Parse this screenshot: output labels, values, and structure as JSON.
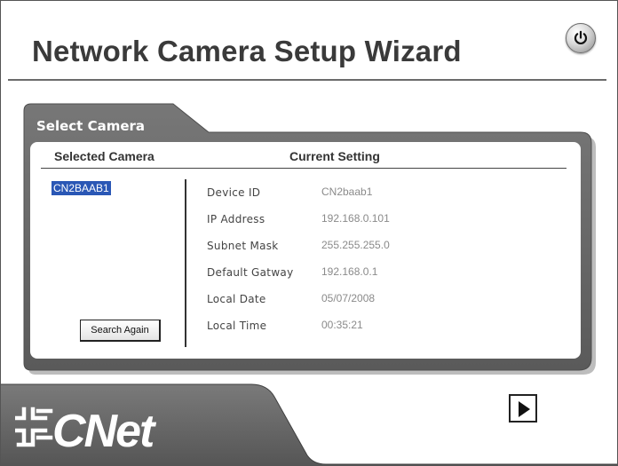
{
  "window": {
    "title": "Network Camera Setup Wizard"
  },
  "panel": {
    "title": "Select Camera",
    "left_header": "Selected Camera",
    "right_header": "Current Setting"
  },
  "camera_list": {
    "items": [
      "CN2BAAB1"
    ],
    "selected": "CN2BAAB1"
  },
  "settings": [
    {
      "label": "Device ID",
      "value": "CN2baab1"
    },
    {
      "label": "IP Address",
      "value": "192.168.0.101"
    },
    {
      "label": "Subnet Mask",
      "value": "255.255.255.0"
    },
    {
      "label": "Default Gatway",
      "value": "192.168.0.1"
    },
    {
      "label": "Local Date",
      "value": "05/07/2008"
    },
    {
      "label": "Local Time",
      "value": "00:35:21"
    }
  ],
  "buttons": {
    "search_again": "Search Again",
    "next_icon": "play-triangle-icon",
    "power_icon": "power-icon"
  },
  "brand": {
    "logo": "CNet"
  },
  "colors": {
    "panel_gray": "#6e6e6e",
    "bottom_band": "#6a6a6a",
    "selection_blue": "#2a57b5"
  }
}
